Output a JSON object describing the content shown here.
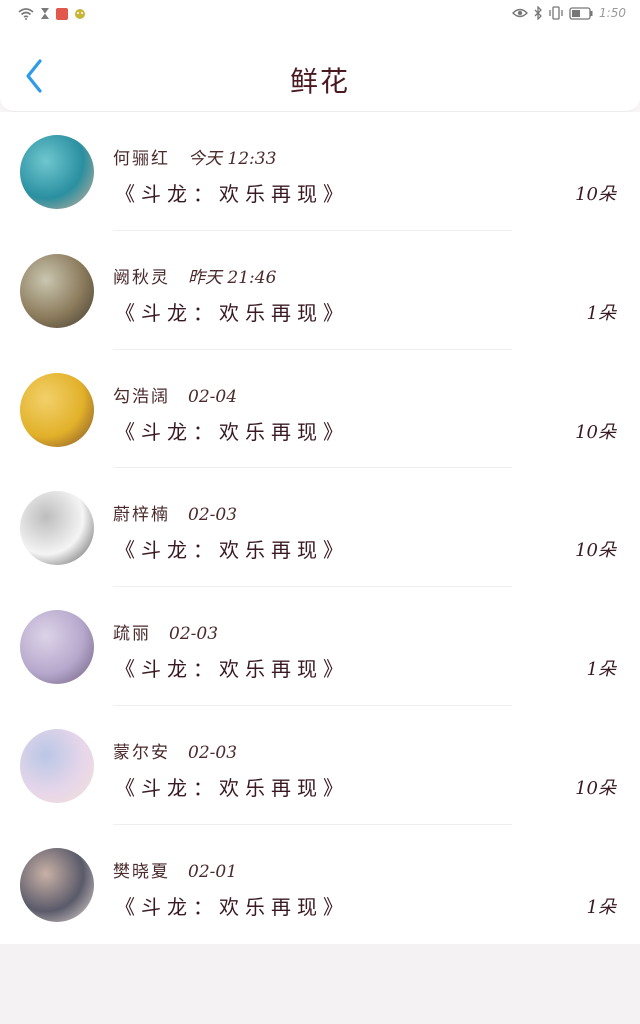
{
  "status_bar": {
    "time": "1:50",
    "icons_left": [
      "wifi-icon",
      "hourglass-icon",
      "app-notification-icon",
      "android-icon"
    ],
    "icons_right": [
      "eye-icon",
      "bluetooth-icon",
      "vibrate-icon",
      "battery-icon"
    ]
  },
  "header": {
    "title": "鲜花",
    "back_icon": "chevron-left-icon",
    "accent_color": "#2f9be8"
  },
  "gifts": [
    {
      "name": "何骊红",
      "time": "今天 12:33",
      "book": "《斗龙：欢乐再现》",
      "count": "10朵",
      "avatar_colors": [
        "#2a8fa0",
        "#6fc7cf",
        "#d9b39a"
      ]
    },
    {
      "name": "阙秋灵",
      "time": "昨天 21:46",
      "book": "《斗龙：欢乐再现》",
      "count": "1朵",
      "avatar_colors": [
        "#8c7b5c",
        "#c9c6b0",
        "#3d3a30"
      ]
    },
    {
      "name": "勾浩阔",
      "time": "02-04",
      "book": "《斗龙：欢乐再现》",
      "count": "10朵",
      "avatar_colors": [
        "#e2b12a",
        "#f2d06a",
        "#7a4a2a"
      ]
    },
    {
      "name": "蔚梓楠",
      "time": "02-03",
      "book": "《斗龙：欢乐再现》",
      "count": "10朵",
      "avatar_colors": [
        "#f4f4f4",
        "#bdbdbd",
        "#4a4a4a"
      ]
    },
    {
      "name": "疏丽",
      "time": "02-03",
      "book": "《斗龙：欢乐再现》",
      "count": "1朵",
      "avatar_colors": [
        "#b6a8cc",
        "#ddd3e8",
        "#6a5a7a"
      ]
    },
    {
      "name": "蒙尔安",
      "time": "02-03",
      "book": "《斗龙：欢乐再现》",
      "count": "10朵",
      "avatar_colors": [
        "#e6d6ea",
        "#b9c7e6",
        "#f3e1d6"
      ]
    },
    {
      "name": "樊晓夏",
      "time": "02-01",
      "book": "《斗龙：欢乐再现》",
      "count": "1朵",
      "avatar_colors": [
        "#5a5a6a",
        "#c9b1a6",
        "#efe3dc"
      ]
    }
  ]
}
